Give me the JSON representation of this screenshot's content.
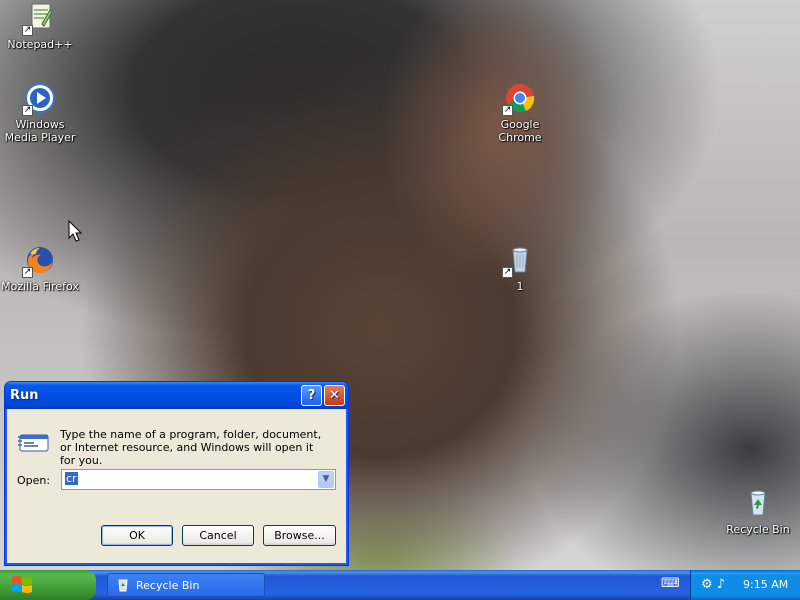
{
  "desktop": {
    "icons": [
      {
        "label": "Notepad++"
      },
      {
        "label": "Windows Media Player"
      },
      {
        "label": "Mozilla Firefox"
      },
      {
        "label": "Google Chrome"
      },
      {
        "label": "1"
      },
      {
        "label": "Recycle Bin"
      }
    ]
  },
  "run_dialog": {
    "title": "Run",
    "help_glyph": "?",
    "close_glyph": "✕",
    "description": "Type the name of a program, folder, document, or Internet resource, and Windows will open it for you.",
    "open_label": "Open:",
    "open_value": "cr",
    "ok_label": "OK",
    "cancel_label": "Cancel",
    "browse_label": "Browse..."
  },
  "taskbar": {
    "task_item": "Recycle Bin",
    "clock": "9:15 AM"
  },
  "colors": {
    "titlebar": "#0050e6",
    "taskbar": "#2663e0",
    "start": "#3d9a34",
    "dialog_bg": "#ece9d8"
  }
}
